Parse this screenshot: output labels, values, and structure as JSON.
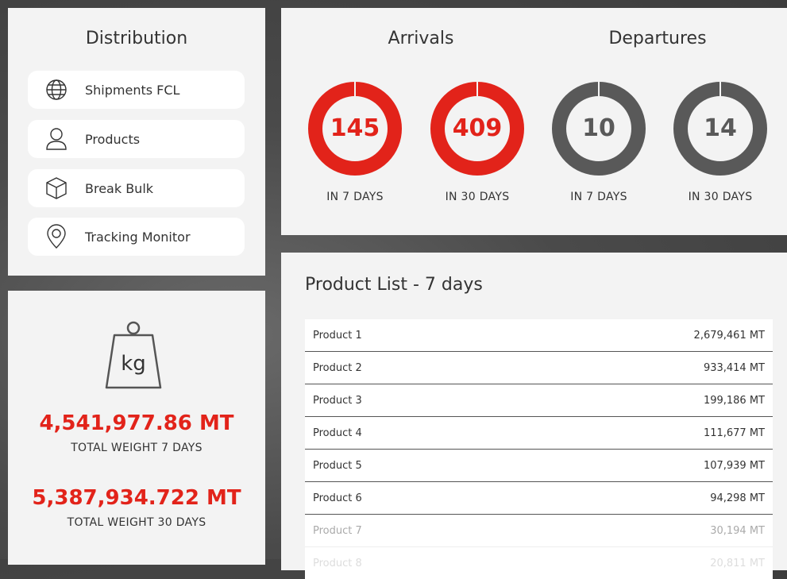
{
  "distribution": {
    "title": "Distribution",
    "items": [
      {
        "label": "Shipments FCL",
        "icon": "globe-icon"
      },
      {
        "label": "Products",
        "icon": "user-icon"
      },
      {
        "label": "Break Bulk",
        "icon": "box-icon"
      },
      {
        "label": "Tracking Monitor",
        "icon": "map-pin-icon"
      }
    ]
  },
  "weight": {
    "icon_label": "kg",
    "total_7": "4,541,977.86 MT",
    "total_7_label": "TOTAL WEIGHT 7 DAYS",
    "total_30": "5,387,934.722 MT",
    "total_30_label": "TOTAL WEIGHT 30 DAYS"
  },
  "arrivals": {
    "title": "Arrivals",
    "color": "#e2231a",
    "items": [
      {
        "value": "145",
        "label": "IN 7 DAYS"
      },
      {
        "value": "409",
        "label": "IN 30 DAYS"
      }
    ]
  },
  "departures": {
    "title": "Departures",
    "color": "#595959",
    "items": [
      {
        "value": "10",
        "label": "IN 7 DAYS"
      },
      {
        "value": "14",
        "label": "IN 30 DAYS"
      }
    ]
  },
  "product_list": {
    "title": "Product List - 7 days",
    "rows": [
      {
        "name": "Product 1",
        "value": "2,679,461 MT"
      },
      {
        "name": "Product 2",
        "value": "933,414 MT"
      },
      {
        "name": "Product 3",
        "value": "199,186 MT"
      },
      {
        "name": "Product 4",
        "value": "111,677 MT"
      },
      {
        "name": "Product 5",
        "value": "107,939 MT"
      },
      {
        "name": "Product 6",
        "value": "94,298 MT"
      },
      {
        "name": "Product 7",
        "value": "30,194 MT"
      },
      {
        "name": "Product 8",
        "value": "20,811 MT"
      }
    ]
  },
  "colors": {
    "accent": "#e2231a",
    "dark": "#595959",
    "card": "#f3f3f3"
  }
}
